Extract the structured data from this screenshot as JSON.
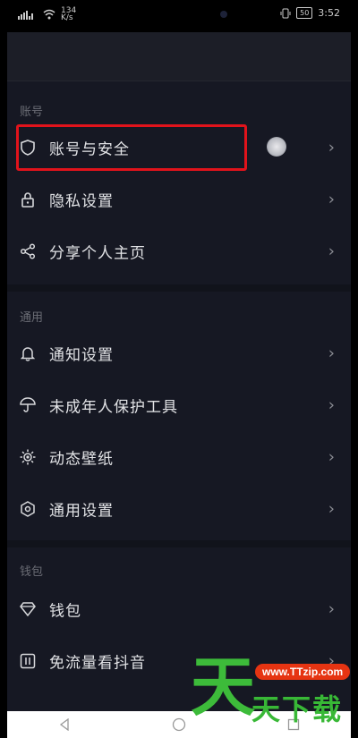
{
  "status_bar": {
    "network_speed": "134\nK/s",
    "battery": "50",
    "time": "3:52"
  },
  "sections": {
    "account": {
      "label": "账号",
      "items": [
        {
          "label": "账号与安全",
          "icon": "shield-icon"
        },
        {
          "label": "隐私设置",
          "icon": "lock-icon"
        },
        {
          "label": "分享个人主页",
          "icon": "share-icon"
        }
      ]
    },
    "general": {
      "label": "通用",
      "items": [
        {
          "label": "通知设置",
          "icon": "bell-icon"
        },
        {
          "label": "未成年人保护工具",
          "icon": "umbrella-icon"
        },
        {
          "label": "动态壁纸",
          "icon": "sun-icon"
        },
        {
          "label": "通用设置",
          "icon": "hexagon-icon"
        }
      ]
    },
    "wallet": {
      "label": "钱包",
      "items": [
        {
          "label": "钱包",
          "icon": "diamond-icon"
        },
        {
          "label": "免流量看抖音",
          "icon": "data-icon"
        }
      ]
    }
  },
  "chevron": "›",
  "watermark": {
    "url": "www.TTzip.com",
    "big": "天",
    "text": "天下载"
  },
  "colors": {
    "background": "#161823",
    "highlight": "#e1131b",
    "watermark_green": "#38b836",
    "watermark_url_bg": "#e63412"
  }
}
